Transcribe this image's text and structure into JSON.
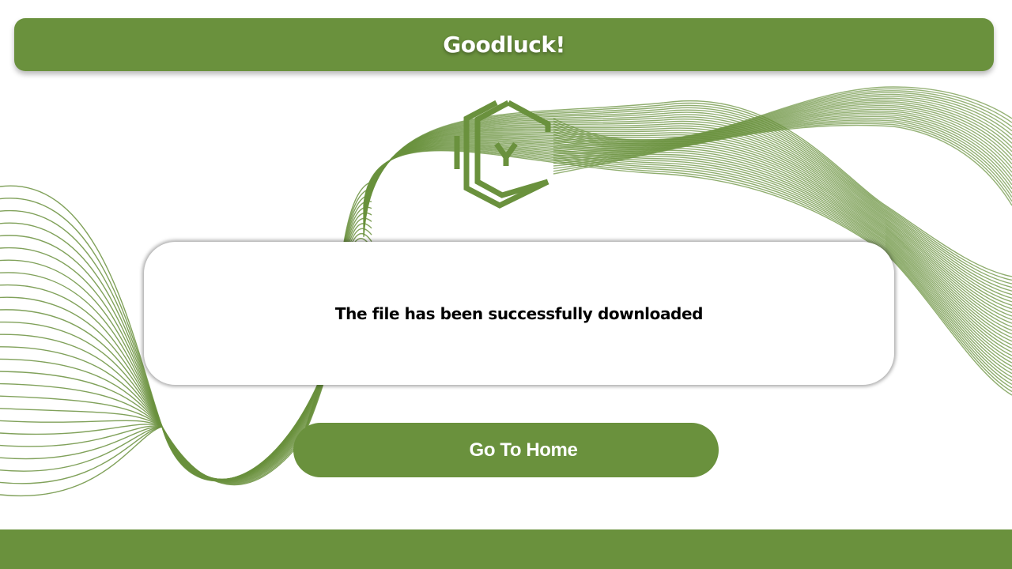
{
  "theme": {
    "accent": "#6a913d",
    "wave_color": "#6a913d"
  },
  "header": {
    "title": "Goodluck!"
  },
  "logo": {
    "icon": "hexagon-chevron-logo-icon"
  },
  "message": {
    "text": "The file has been successfully downloaded"
  },
  "actions": {
    "home_label": "Go To Home"
  },
  "footer": {},
  "decor": {
    "icon": "wave-lines-pattern"
  }
}
